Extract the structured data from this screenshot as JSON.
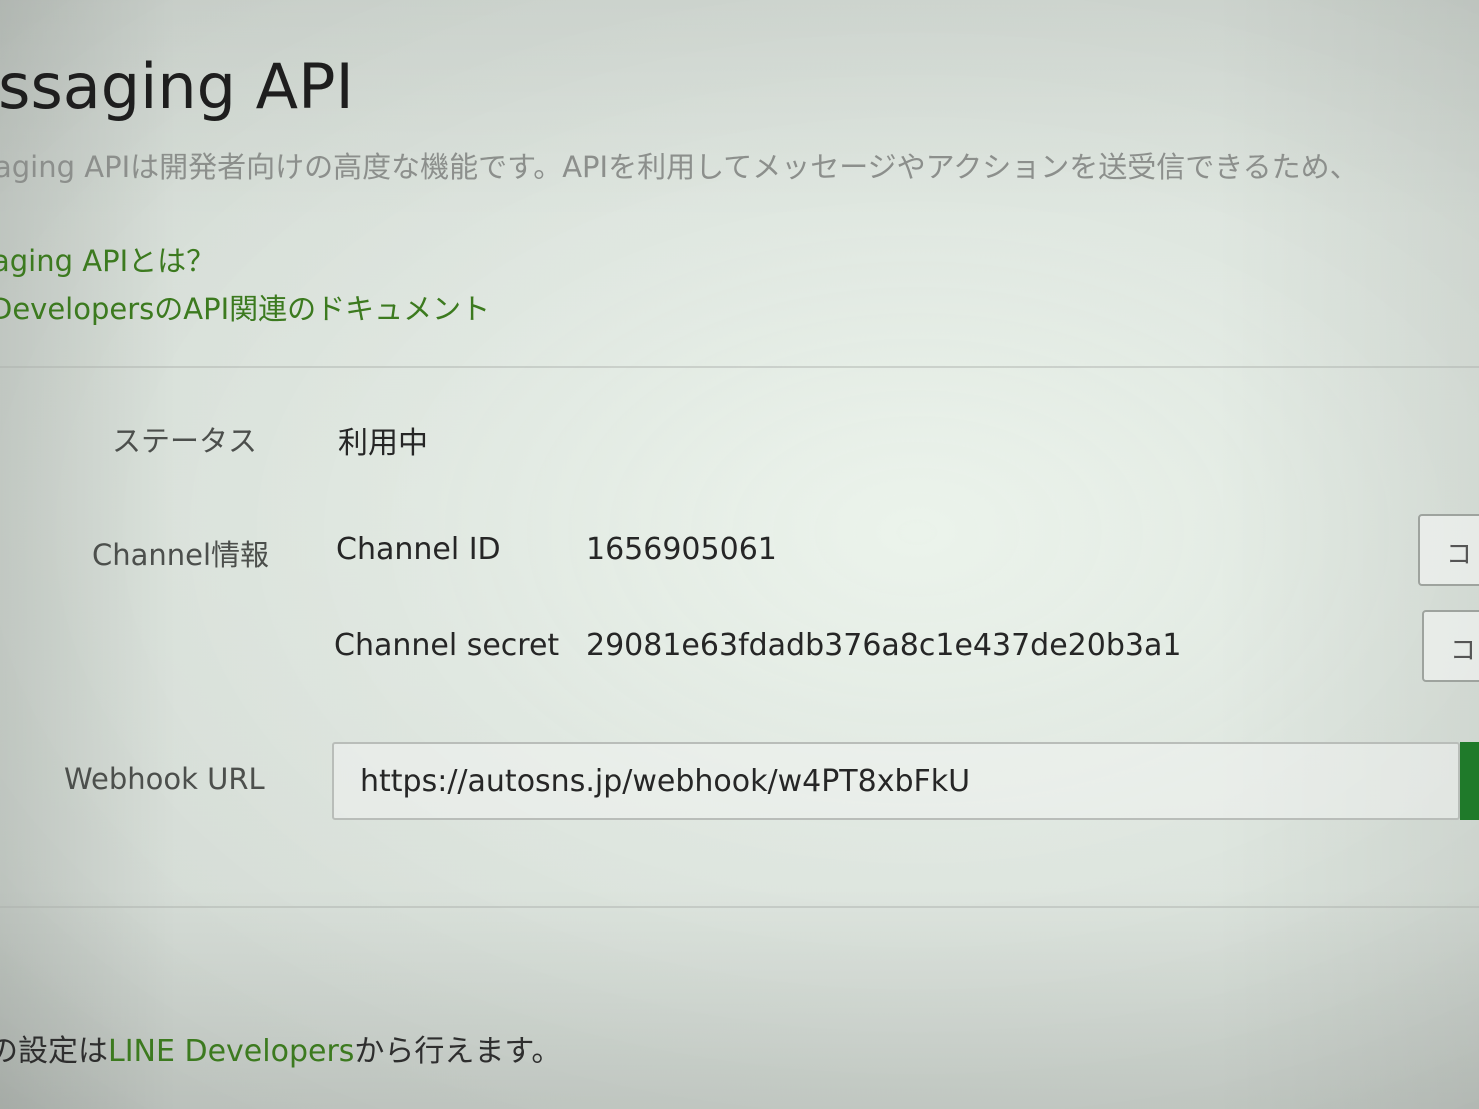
{
  "header": {
    "title": "essaging API",
    "description": "aging APIは開発者向けの高度な機能です。APIを利用してメッセージやアクションを送受信できるため、"
  },
  "links": [
    "aging APIとは？",
    "DevelopersのAPI関連のドキュメント"
  ],
  "status": {
    "label": "ステータス",
    "value": "利用中"
  },
  "channel_info": {
    "label": "Channel情報",
    "id_label": "Channel ID",
    "id_value": "1656905061",
    "secret_label": "Channel secret",
    "secret_value": "29081e63fdadb376a8c1e437de20b3a1",
    "copy_label": "コ"
  },
  "webhook": {
    "label": "Webhook URL",
    "value": "https://autosns.jp/webhook/w4PT8xbFkU",
    "accent_color": "#1f7a2a"
  },
  "footer": {
    "prefix": "の設定は",
    "link": "LINE Developers",
    "suffix": "から行えます。"
  }
}
